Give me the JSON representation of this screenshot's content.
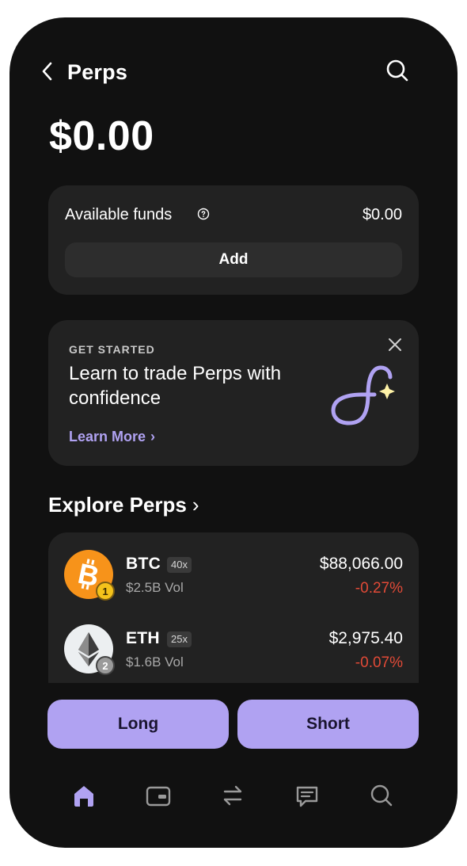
{
  "header": {
    "title": "Perps",
    "back_icon": "chevron-left-icon",
    "search_icon": "search-icon"
  },
  "balance": "$0.00",
  "funds": {
    "label": "Available funds",
    "value": "$0.00",
    "add_label": "Add"
  },
  "promo": {
    "eyebrow": "GET STARTED",
    "title": "Learn to trade Perps with confidence",
    "link": "Learn More",
    "link_chevron": "›"
  },
  "explore": {
    "title": "Explore Perps",
    "chevron": "›"
  },
  "markets": [
    {
      "symbol": "BTC",
      "leverage": "40x",
      "volume": "$2.5B Vol",
      "price": "$88,066.00",
      "change": "-0.27%",
      "rank": "1"
    },
    {
      "symbol": "ETH",
      "leverage": "25x",
      "volume": "$1.6B Vol",
      "price": "$2,975.40",
      "change": "-0.07%",
      "rank": "2"
    }
  ],
  "actions": {
    "long": "Long",
    "short": "Short"
  },
  "tabs": [
    "home-icon",
    "wallet-icon",
    "swap-icon",
    "chat-icon",
    "search-icon"
  ],
  "colors": {
    "accent": "#b0a2f2",
    "negative": "#e24a37",
    "background": "#121212",
    "card": "#222222"
  }
}
